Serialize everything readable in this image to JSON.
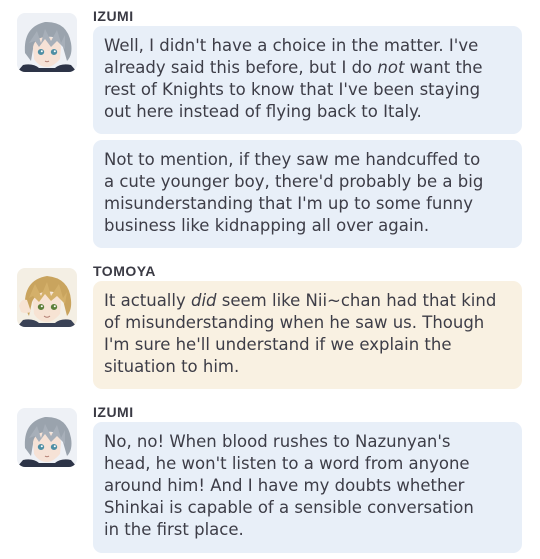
{
  "conversation": [
    {
      "speaker": "IZUMI",
      "avatar_icon": "izumi-avatar",
      "bubble_color": "#e8eff8",
      "messages": [
        {
          "lines": [
            [
              {
                "t": "Well, I didn't have a choice in the matter. I've"
              }
            ],
            [
              {
                "t": "already said this before, but I do "
              },
              {
                "t": "not",
                "i": true
              },
              {
                "t": " want the"
              }
            ],
            [
              {
                "t": "rest of Knights to know that I've been staying"
              }
            ],
            [
              {
                "t": "out here instead of flying back to Italy."
              }
            ]
          ]
        },
        {
          "lines": [
            [
              {
                "t": "Not to mention, if they saw me handcuffed to"
              }
            ],
            [
              {
                "t": "a cute younger boy, there'd probably be a big"
              }
            ],
            [
              {
                "t": "misunderstanding that I'm up to some funny"
              }
            ],
            [
              {
                "t": "business like kidnapping all over again."
              }
            ]
          ]
        }
      ]
    },
    {
      "speaker": "TOMOYA",
      "avatar_icon": "tomoya-avatar",
      "bubble_color": "#f9f1e2",
      "messages": [
        {
          "lines": [
            [
              {
                "t": "It actually "
              },
              {
                "t": "did",
                "i": true
              },
              {
                "t": " seem like Nii~chan had that kind"
              }
            ],
            [
              {
                "t": "of misunderstanding when he saw us. Though"
              }
            ],
            [
              {
                "t": "I'm sure he'll understand if we explain the"
              }
            ],
            [
              {
                "t": "situation to him."
              }
            ]
          ]
        }
      ]
    },
    {
      "speaker": "IZUMI",
      "avatar_icon": "izumi-avatar",
      "bubble_color": "#e8eff8",
      "messages": [
        {
          "lines": [
            [
              {
                "t": "No, no! When blood rushes to Nazunyan's"
              }
            ],
            [
              {
                "t": "head, he won't listen to a word from anyone"
              }
            ],
            [
              {
                "t": "around him! And I have my doubts whether"
              }
            ],
            [
              {
                "t": "Shinkai is capable of a sensible conversation"
              }
            ],
            [
              {
                "t": "in the first place."
              }
            ]
          ]
        }
      ]
    }
  ]
}
